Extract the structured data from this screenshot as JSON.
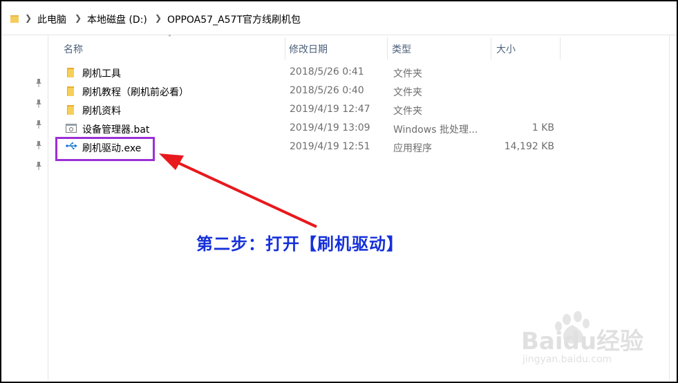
{
  "breadcrumb": {
    "items": [
      "此电脑",
      "本地磁盘 (D:)",
      "OPPOA57_A57T官方线刷机包"
    ]
  },
  "columns": {
    "name": "名称",
    "date": "修改日期",
    "type": "类型",
    "size": "大小"
  },
  "files": [
    {
      "name": "刷机工具",
      "date": "2018/5/26 0:41",
      "type": "文件夹",
      "size": "",
      "icon": "folder-icon"
    },
    {
      "name": "刷机教程（刷机前必看）",
      "date": "2018/5/26 0:40",
      "type": "文件夹",
      "size": "",
      "icon": "folder-icon"
    },
    {
      "name": "刷机资料",
      "date": "2019/4/19 12:47",
      "type": "文件夹",
      "size": "",
      "icon": "folder-icon"
    },
    {
      "name": "设备管理器.bat",
      "date": "2019/4/19 13:09",
      "type": "Windows 批处理...",
      "size": "1 KB",
      "icon": "batch-file-icon"
    },
    {
      "name": "刷机驱动.exe",
      "date": "2019/4/19 12:51",
      "type": "应用程序",
      "size": "14,192 KB",
      "icon": "usb-icon"
    }
  ],
  "annotation": "第二步：打开【刷机驱动】",
  "watermark": {
    "brand": "Baidu经验",
    "url": "jingyan.baidu.com"
  },
  "colors": {
    "annotation_text": "#1530d8",
    "highlight_box": "#9b2fd6",
    "arrow": "#e8191d",
    "folder": "#f0c040"
  }
}
